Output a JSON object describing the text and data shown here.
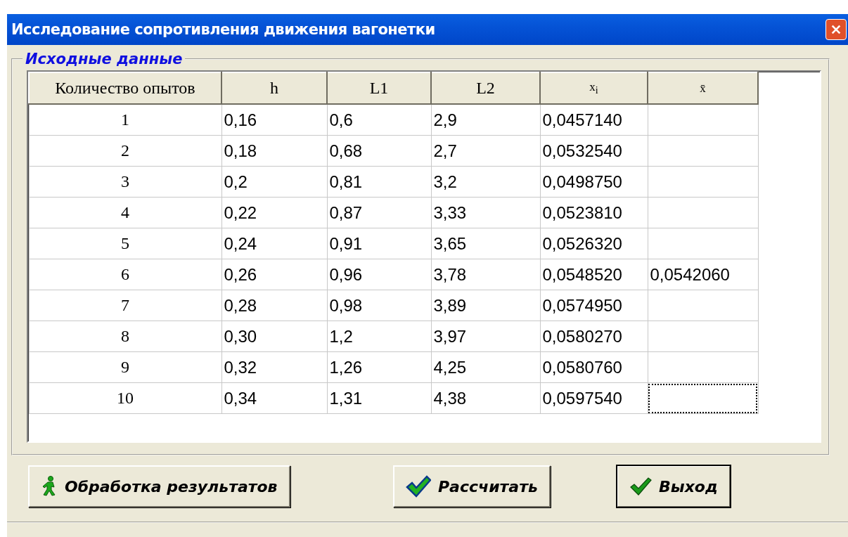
{
  "window": {
    "title": "Исследование сопротивления движения вагонетки"
  },
  "group": {
    "title": "Исходные данные"
  },
  "table": {
    "columns": [
      "Количество опытов",
      "h",
      "L1",
      "L2",
      "x$_{i}$",
      "x̄"
    ],
    "rows": [
      {
        "n": "1",
        "h": "0,16",
        "l1": "0,6",
        "l2": "2,9",
        "xi": "0,0457140",
        "focused": false
      },
      {
        "n": "2",
        "h": "0,18",
        "l1": "0,68",
        "l2": "2,7",
        "xi": "0,0532540",
        "focused": false
      },
      {
        "n": "3",
        "h": "0,2",
        "l1": "0,81",
        "l2": "3,2",
        "xi": "0,0498750",
        "focused": false
      },
      {
        "n": "4",
        "h": "0,22",
        "l1": "0,87",
        "l2": "3,33",
        "xi": "0,0523810",
        "focused": false
      },
      {
        "n": "5",
        "h": "0,24",
        "l1": "0,91",
        "l2": "3,65",
        "xi": "0,0526320",
        "focused": false
      },
      {
        "n": "6",
        "h": "0,26",
        "l1": "0,96",
        "l2": "3,78",
        "xi": "0,0548520",
        "xbar": "0,0542060",
        "focused": false
      },
      {
        "n": "7",
        "h": "0,28",
        "l1": "0,98",
        "l2": "3,89",
        "xi": "0,0574950",
        "focused": false
      },
      {
        "n": "8",
        "h": "0,30",
        "l1": "1,2",
        "l2": "3,97",
        "xi": "0,0580270",
        "focused": false
      },
      {
        "n": "9",
        "h": "0,32",
        "l1": "1,26",
        "l2": "4,25",
        "xi": "0,0580760",
        "focused": false
      },
      {
        "n": "10",
        "h": "0,34",
        "l1": "1,31",
        "l2": "4,38",
        "xi": "0,0597540",
        "focused": true
      }
    ]
  },
  "buttons": [
    {
      "label": "Обработка результатов",
      "kind": "process",
      "default": false
    },
    {
      "label": "Рассчитать",
      "kind": "calculate",
      "default": false
    },
    {
      "label": "Выход",
      "kind": "exit",
      "default": true
    }
  ]
}
